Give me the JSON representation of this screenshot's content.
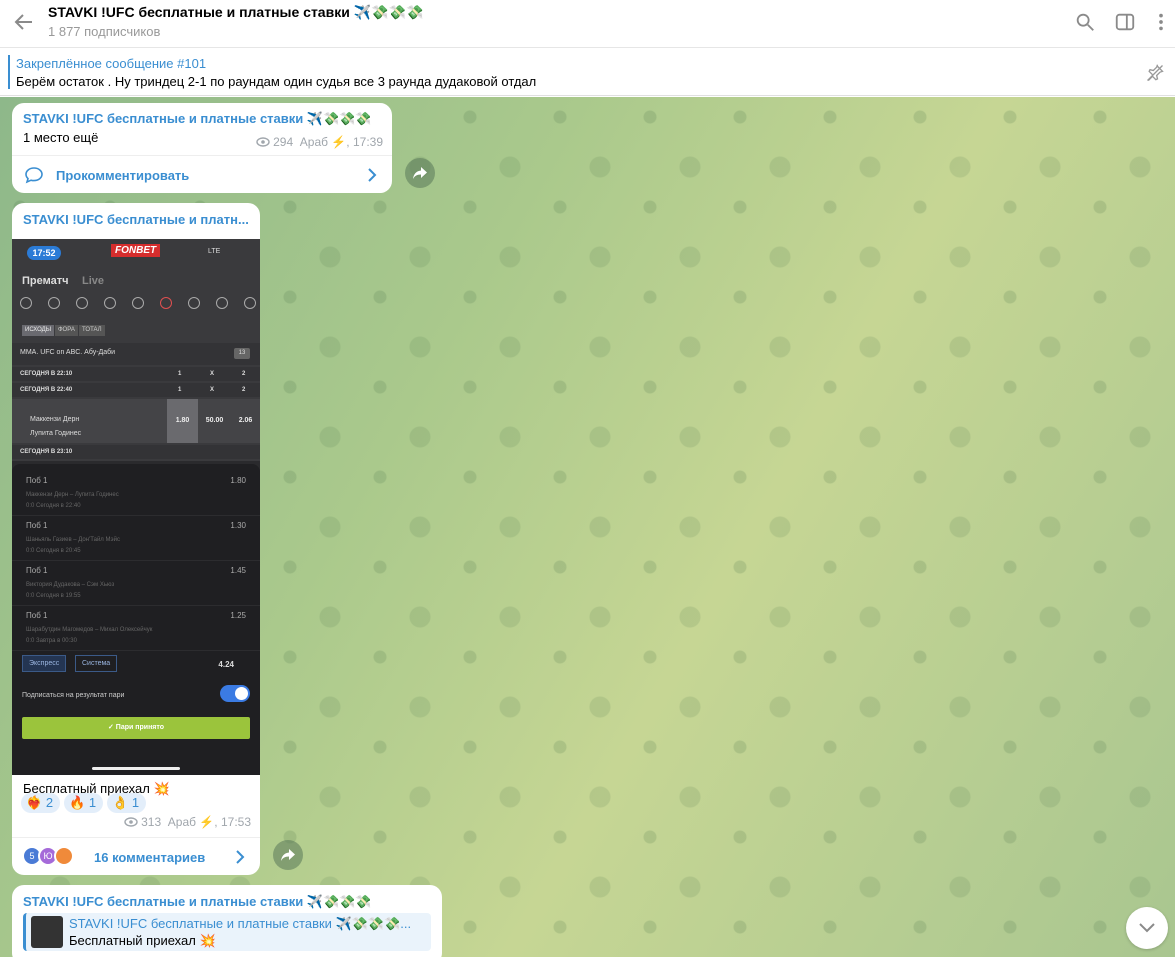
{
  "header": {
    "title": "STAVKI !UFC бесплатные и платные ставки ✈️💸💸💸",
    "subscribers": "1 877 подписчиков",
    "icons": [
      "back-arrow-icon",
      "search-icon",
      "sidebar-toggle-icon",
      "more-vertical-icon"
    ]
  },
  "pinned": {
    "label": "Закреплённое сообщение #101",
    "text": "Берём остаток . Ну триндец 2-1 по раундам один судья все 3 раунда дудаковой отдал",
    "icon": "unpin-icon"
  },
  "messages": [
    {
      "sender": "STAVKI !UFC бесплатные и платные ставки ✈️💸💸💸",
      "text": "1 место ещё",
      "views": "294",
      "author_time": "Араб ⚡️, 17:39",
      "comment_label": "Прокомментировать"
    },
    {
      "sender": "STAVKI !UFC бесплатные и платн...",
      "caption": "Бесплатный приехал 💥",
      "reactions": [
        {
          "emoji": "❤️‍🔥",
          "count": "2"
        },
        {
          "emoji": "🔥",
          "count": "1"
        },
        {
          "emoji": "👌",
          "count": "1"
        }
      ],
      "views": "313",
      "author_time": "Араб ⚡️, 17:53",
      "comments_label": "16 комментариев",
      "avatars": [
        {
          "letter": "5",
          "color": "#4a7bd6"
        },
        {
          "letter": "Ю",
          "color": "#a56ad9"
        },
        {
          "letter": "",
          "color": "#f08a3a"
        }
      ]
    },
    {
      "sender": "STAVKI !UFC бесплатные и платные ставки ✈️💸💸💸",
      "reply_sender": "STAVKI !UFC бесплатные и платные ставки ✈️💸💸💸...",
      "reply_text": "Бесплатный приехал 💥"
    }
  ],
  "screenshot": {
    "time": "17:52",
    "brand": "FONBET",
    "network": "LTE",
    "tab_prematch": "Прематч",
    "tab_live": "Live",
    "chips": [
      "ИСХОДЫ",
      "ФОРА",
      "ТОТАЛ"
    ],
    "league": "MMA. UFC on ABC. Абу-Даби",
    "league_count": "13",
    "rows": [
      {
        "label": "СЕГОДНЯ В 22:10",
        "c1": "1",
        "c2": "X",
        "c3": "2"
      },
      {
        "label": "СЕГОДНЯ В 22:40",
        "c1": "1",
        "c2": "X",
        "c3": "2"
      },
      {
        "label": "СЕГОДНЯ В 23:10",
        "c1": "",
        "c2": "",
        "c3": ""
      }
    ],
    "match_p1": "Маккензи Дерн",
    "match_p2": "Лупита Годинес",
    "odds": [
      "1.80",
      "50.00",
      "2.06"
    ],
    "bets": [
      {
        "type": "Поб 1",
        "odd": "1.80",
        "match": "Маккензи Дерн – Лупита Годинес",
        "date": "0:0   Сегодня в 22:40"
      },
      {
        "type": "Поб 1",
        "odd": "1.30",
        "match": "Шаньяль Газиев – Дон'Тайл Мэйс",
        "date": "0:0   Сегодня в 20:45"
      },
      {
        "type": "Поб 1",
        "odd": "1.45",
        "match": "Виктория Дудакова – Сэм Хьюз",
        "date": "0:0   Сегодня в 19:55"
      },
      {
        "type": "Поб 1",
        "odd": "1.25",
        "match": "Шарабутдин Магомедов – Михал Олексейчук",
        "date": "0:0   Завтра в 00:30"
      }
    ],
    "btn_express": "Экспресс",
    "btn_system": "Система",
    "total": "4.24",
    "subscribe_text": "Подписаться на результат пари",
    "accept_label": "✓  Пари принято"
  },
  "colors": {
    "accent": "#3a8ed1",
    "chat_bg": "#a9c690"
  }
}
